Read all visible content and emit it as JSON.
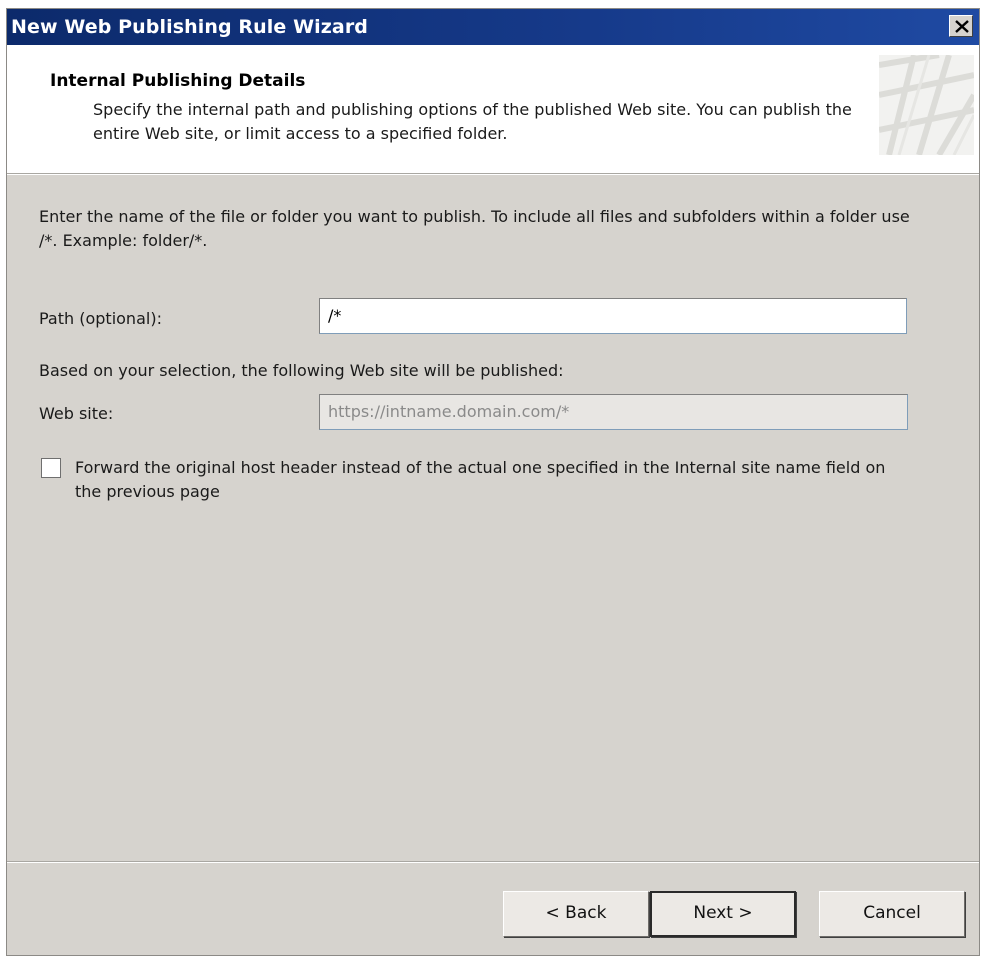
{
  "window": {
    "title": "New Web Publishing Rule Wizard",
    "close_icon": "close-icon"
  },
  "header": {
    "title": "Internal Publishing Details",
    "description": "Specify the internal path and publishing options of the published Web site. You can publish the entire Web site, or limit access to a specified folder."
  },
  "main": {
    "instructions": "Enter the name of the file or folder you want to publish. To include all files and subfolders within a folder use /*. Example: folder/*.",
    "path_label": "Path (optional):",
    "path_value": "/*",
    "based_on_text": "Based on your selection, the following Web site will be published:",
    "website_label": "Web site:",
    "website_value": "https://intname.domain.com/*",
    "forward_checkbox_label": "Forward the original host header instead of the actual one specified in the Internal site name field on the previous page",
    "forward_checked": false
  },
  "buttons": {
    "back": "< Back",
    "next": "Next >",
    "cancel": "Cancel"
  },
  "colors": {
    "titlebar": "#163a8a",
    "dialog_bg": "#d6d3ce"
  }
}
